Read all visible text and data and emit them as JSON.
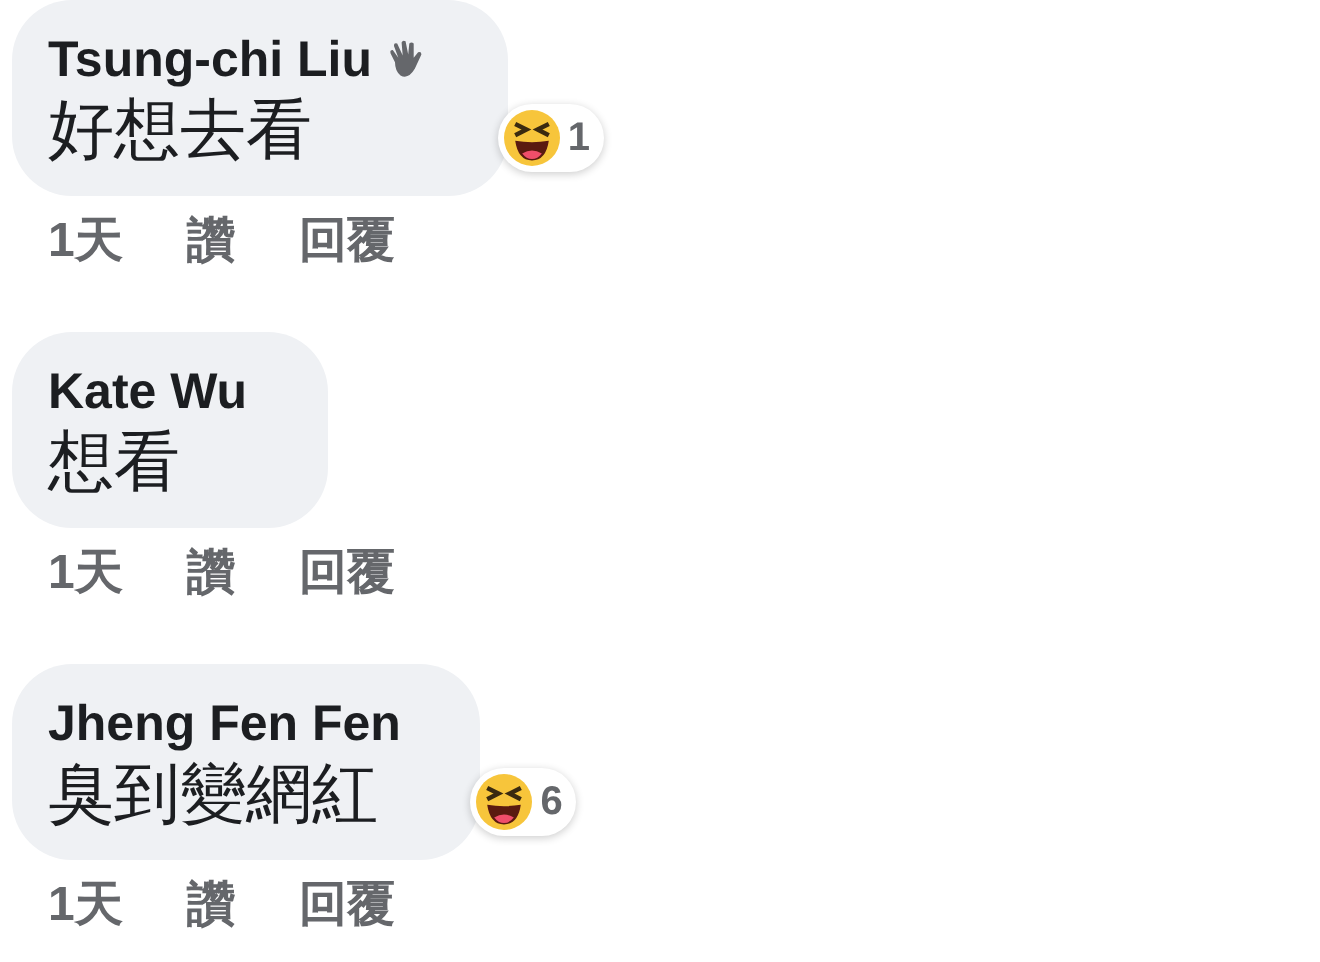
{
  "comments": [
    {
      "author": "Tsung-chi Liu",
      "wave_badge": true,
      "text": "好想去看",
      "reaction_count": "1",
      "time": "1天",
      "like": "讚",
      "reply": "回覆"
    },
    {
      "author": "Kate Wu",
      "wave_badge": false,
      "text": "想看",
      "time": "1天",
      "like": "讚",
      "reply": "回覆"
    },
    {
      "author": "Jheng Fen Fen",
      "wave_badge": false,
      "text": "臭到變網紅",
      "reaction_count": "6",
      "time": "1天",
      "like": "讚",
      "reply": "回覆"
    }
  ]
}
